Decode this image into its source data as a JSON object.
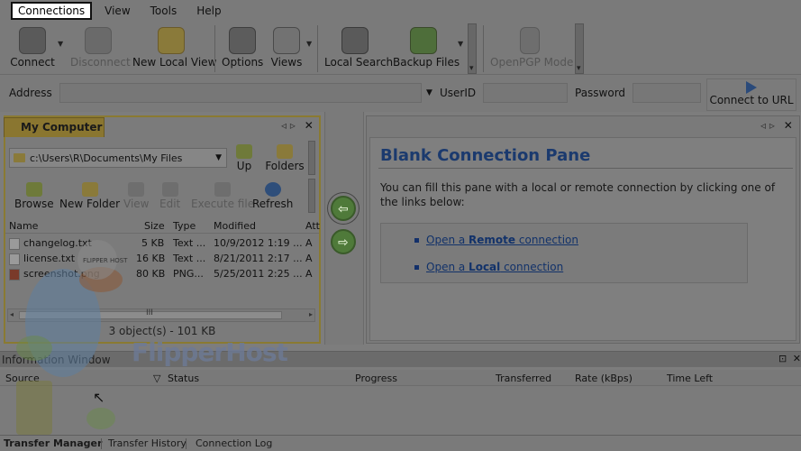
{
  "menu": [
    {
      "label": "Connections",
      "active": true
    },
    {
      "label": "View",
      "active": false
    },
    {
      "label": "Tools",
      "active": false
    },
    {
      "label": "Help",
      "active": false
    }
  ],
  "toolbar": {
    "connect": "Connect",
    "disconnect": "Disconnect",
    "new_local_view": "New Local View",
    "options": "Options",
    "views": "Views",
    "local_search": "Local Search",
    "backup_files": "Backup Files",
    "openpgp_mode": "OpenPGP Mode"
  },
  "address_bar": {
    "address_label": "Address",
    "userid_label": "UserID",
    "password_label": "Password",
    "connect_to_url": "Connect to URL"
  },
  "left_pane": {
    "tab_title": "My Computer",
    "path": "c:\\Users\\R\\Documents\\My Files",
    "up": "Up",
    "folders": "Folders",
    "tools": {
      "browse": "Browse",
      "new_folder": "New Folder",
      "view": "View",
      "edit": "Edit",
      "execute_file": "Execute file",
      "refresh": "Refresh"
    },
    "columns": {
      "name": "Name",
      "size": "Size",
      "type": "Type",
      "modified": "Modified",
      "attr": "Att"
    },
    "files": [
      {
        "name": "changelog.txt",
        "size": "5 KB",
        "type": "Text ...",
        "modified": "10/9/2012 1:19 ...",
        "attr": "A"
      },
      {
        "name": "license.txt",
        "size": "16 KB",
        "type": "Text ...",
        "modified": "8/21/2011 2:17 ...",
        "attr": "A"
      },
      {
        "name": "screenshot.png",
        "size": "80 KB",
        "type": "PNG...",
        "modified": "5/25/2011 2:25 ...",
        "attr": "A"
      }
    ],
    "scroll_grip": "III",
    "status": "3 object(s) - 101 KB"
  },
  "right_pane": {
    "title": "Blank Connection Pane",
    "description": "You can fill this pane with a local or remote connection by clicking one of the links below:",
    "remote_link": {
      "prefix": "Open a ",
      "bold": "Remote",
      "suffix": " connection"
    },
    "local_link": {
      "prefix": "Open a ",
      "bold": "Local",
      "suffix": " connection"
    }
  },
  "info_window": {
    "title": "Information Window",
    "columns": {
      "source": "Source",
      "status": "Status",
      "progress": "Progress",
      "transferred": "Transferred",
      "rate": "Rate (kBps)",
      "time_left": "Time Left"
    }
  },
  "bottom_tabs": [
    {
      "label": "Transfer Manager",
      "active": true
    },
    {
      "label": "Transfer History",
      "active": false
    },
    {
      "label": "Connection Log",
      "active": false
    }
  ],
  "watermark": {
    "text": "FlipperHost",
    "badge": "FLIPPER HOST"
  },
  "colors": {
    "accent": "#1b3a6e",
    "link": "#12326a",
    "pane_border": "#8a7a32"
  }
}
